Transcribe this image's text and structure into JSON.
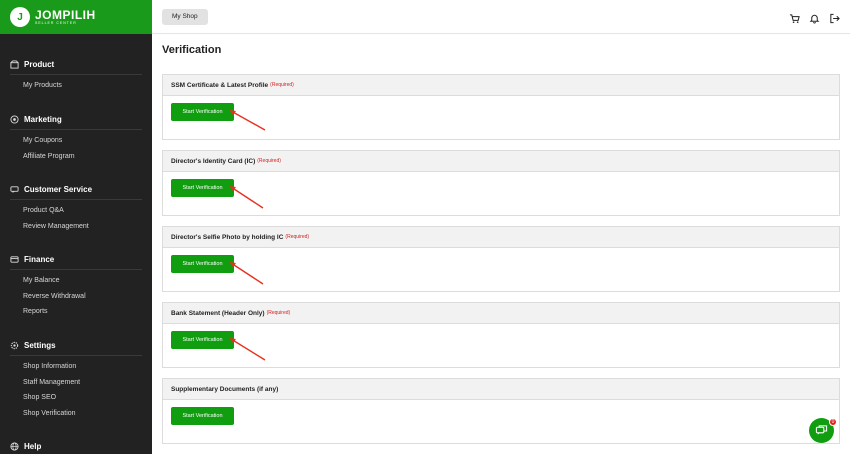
{
  "brand": {
    "name": "JOMPILIH",
    "subtitle": "SELLER CENTER",
    "mark": "J"
  },
  "sidebar": {
    "sections": [
      {
        "title": "Product",
        "icon": "box-icon",
        "items": [
          "My Products"
        ]
      },
      {
        "title": "Marketing",
        "icon": "target-icon",
        "items": [
          "My Coupons",
          "Affiliate Program"
        ]
      },
      {
        "title": "Customer Service",
        "icon": "chat-icon",
        "items": [
          "Product Q&A",
          "Review Management"
        ]
      },
      {
        "title": "Finance",
        "icon": "wallet-icon",
        "items": [
          "My Balance",
          "Reverse Withdrawal",
          "Reports"
        ]
      },
      {
        "title": "Settings",
        "icon": "gear-icon",
        "items": [
          "Shop Information",
          "Staff Management",
          "Shop SEO",
          "Shop Verification"
        ]
      },
      {
        "title": "Help",
        "icon": "globe-icon",
        "items": []
      }
    ]
  },
  "topbar": {
    "shop_tab": "My Shop",
    "icons": [
      "cart-icon",
      "bell-icon",
      "logout-icon"
    ]
  },
  "main": {
    "title": "Verification",
    "button_label": "Start Verification",
    "required_label": "(Required)",
    "cards": [
      {
        "title": "SSM Certificate & Latest Profile",
        "required": true
      },
      {
        "title": "Director's Identity Card (IC)",
        "required": true
      },
      {
        "title": "Director's Selfie Photo by holding IC",
        "required": true
      },
      {
        "title": "Bank Statement (Header Only)",
        "required": true
      },
      {
        "title": "Supplementary Documents (if any)",
        "required": false
      }
    ]
  },
  "chat": {
    "badge": "0"
  },
  "colors": {
    "brand_green": "#1a9a1a",
    "button_green": "#109e10",
    "sidebar_bg": "#222222",
    "required_red": "#d32020",
    "arrow_red": "#e8301c"
  }
}
